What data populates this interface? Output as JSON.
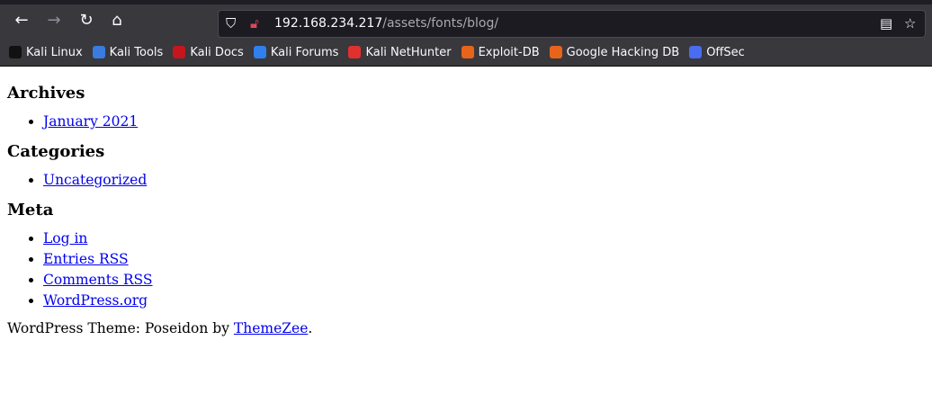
{
  "browser": {
    "url_host": "192.168.234.217",
    "url_path": "/assets/fonts/blog/",
    "bookmarks": [
      {
        "label": "Kali Linux",
        "color": "#111111"
      },
      {
        "label": "Kali Tools",
        "color": "#3b7be0"
      },
      {
        "label": "Kali Docs",
        "color": "#c4161c"
      },
      {
        "label": "Kali Forums",
        "color": "#2f80ed"
      },
      {
        "label": "Kali NetHunter",
        "color": "#e0312f"
      },
      {
        "label": "Exploit-DB",
        "color": "#e8641b"
      },
      {
        "label": "Google Hacking DB",
        "color": "#e8641b"
      },
      {
        "label": "OffSec",
        "color": "#4a6cf0"
      }
    ]
  },
  "page": {
    "archives": {
      "title": "Archives",
      "items": [
        "January 2021"
      ]
    },
    "categories": {
      "title": "Categories",
      "items": [
        "Uncategorized"
      ]
    },
    "meta": {
      "title": "Meta",
      "items": [
        "Log in",
        "Entries RSS",
        "Comments RSS",
        "WordPress.org"
      ]
    },
    "footer": {
      "prefix": "WordPress Theme: Poseidon by ",
      "link": "ThemeZee",
      "suffix": "."
    }
  }
}
